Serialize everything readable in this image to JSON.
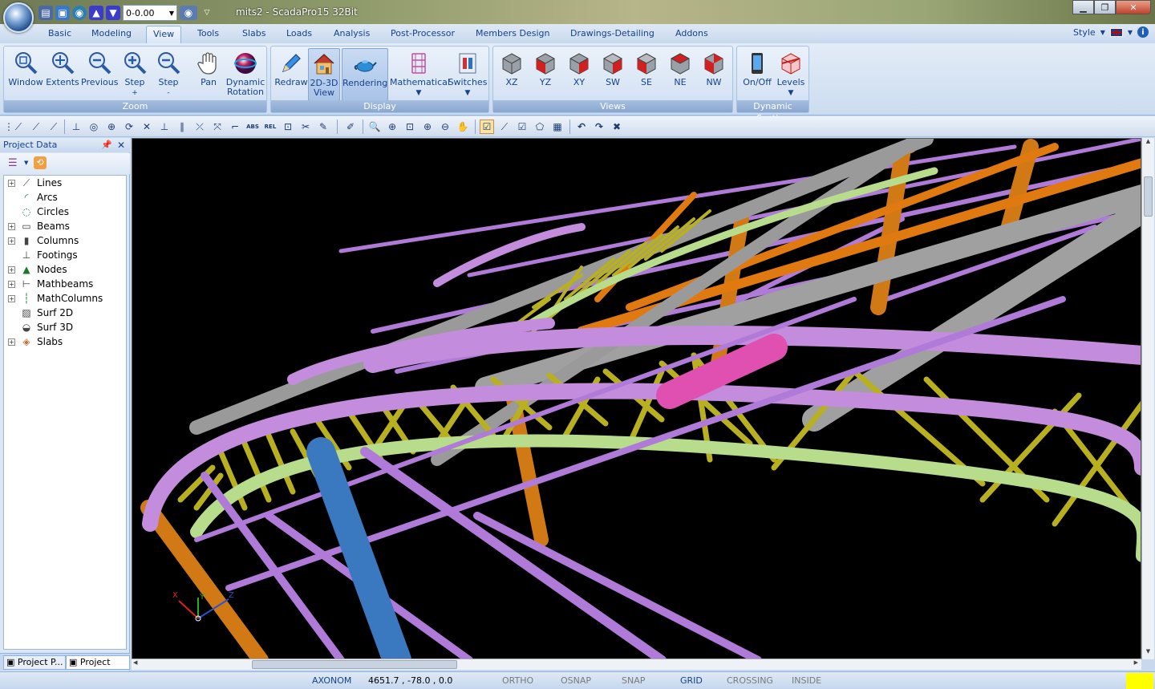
{
  "window": {
    "title": "mits2 - ScadaPro15 32Bit"
  },
  "qat": {
    "value_field": "0-0.00"
  },
  "tabs": [
    "Basic",
    "Modeling",
    "View",
    "Tools",
    "Slabs",
    "Loads",
    "Analysis",
    "Post-Processor",
    "Members Design",
    "Drawings-Detailing",
    "Addons"
  ],
  "active_tab": "View",
  "style_menu": {
    "label": "Style"
  },
  "ribbon": {
    "zoom": {
      "caption": "Zoom",
      "buttons": [
        "Window",
        "Extents",
        "Previous",
        "Step",
        "Step",
        "Pan",
        "Dynamic",
        "Rotation"
      ],
      "step_in_sign": "+",
      "step_out_sign": "-"
    },
    "display": {
      "caption": "Display",
      "redraw": "Redraw",
      "view_line1": "2D-3D",
      "view_line2": "View",
      "rendering": "Rendering",
      "mathematical": "Mathematical",
      "switches": "Switches"
    },
    "views": {
      "caption": "Views",
      "buttons": [
        "XZ",
        "YZ",
        "XY",
        "SW",
        "SE",
        "NE",
        "NW"
      ]
    },
    "dynamic_section": {
      "caption": "Dynamic Section",
      "onoff": "On/Off",
      "levels": "Levels"
    }
  },
  "panel": {
    "title": "Project Data",
    "tree": [
      "Lines",
      "Arcs",
      "Circles",
      "Beams",
      "Columns",
      "Footings",
      "Nodes",
      "Mathbeams",
      "MathColumns",
      "Surf 2D",
      "Surf 3D",
      "Slabs"
    ],
    "tabs": [
      "Project P...",
      "Project D..."
    ]
  },
  "viewport": {
    "axis_labels": [
      "X",
      "Y",
      "Z"
    ]
  },
  "status": {
    "view_mode": "AXONOM",
    "coords": "4651.7 , -78.0 , 0.0",
    "toggles": [
      "ORTHO",
      "OSNAP",
      "SNAP",
      "GRID",
      "CROSSING",
      "INSIDE"
    ],
    "active_toggle": "GRID",
    "indicator_color": "#ffff00"
  }
}
